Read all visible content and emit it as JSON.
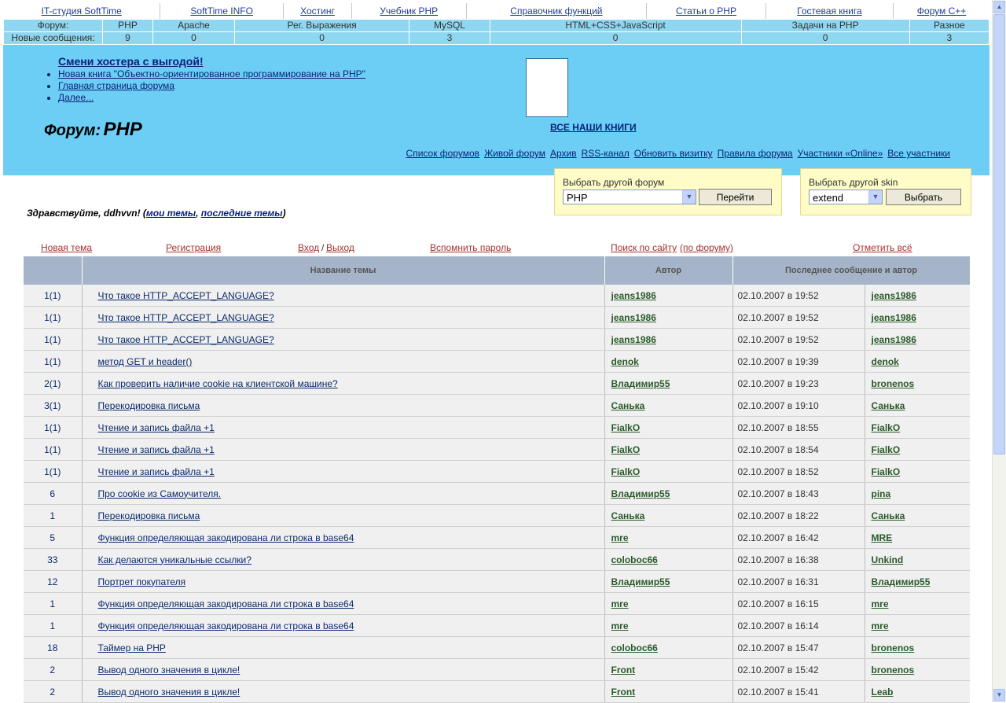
{
  "topnav": [
    "IT-студия SoftTime",
    "SoftTime INFO",
    "Хостинг",
    "Учебник PHP",
    "Справочник функций",
    "Статьи о PHP",
    "Гостевая книга",
    "Форум C++"
  ],
  "stats": {
    "forum_label": "Форум:",
    "new_label": "Новые сообщения:",
    "forums": [
      {
        "name": "PHP",
        "count": "9"
      },
      {
        "name": "Apache",
        "count": "0"
      },
      {
        "name": "Рег. Выражения",
        "count": "0"
      },
      {
        "name": "MySQL",
        "count": "3"
      },
      {
        "name": "HTML+CSS+JavaScript",
        "count": "0"
      },
      {
        "name": "Задачи на PHP",
        "count": "0"
      },
      {
        "name": "Разное",
        "count": "3"
      }
    ]
  },
  "banner": {
    "promo_title": "Смени хостера с выгодой!",
    "promo_links": [
      "Новая книга \"Объектно-ориентированное программирование на PHP\"",
      "Главная страница форума",
      "Далее..."
    ],
    "all_books": "ВСЕ НАШИ КНИГИ",
    "forum_label": "Форум:",
    "forum_name": "PHP",
    "links": [
      "Список форумов",
      "Живой форум",
      "Архив",
      "RSS-канал",
      "Обновить визитку",
      "Правила форума",
      "Участники «Online»",
      "Все участники"
    ]
  },
  "forum_select": {
    "caption": "Выбрать другой форум",
    "value": "PHP",
    "button": "Перейти"
  },
  "skin_select": {
    "caption": "Выбрать другой skin",
    "value": "extend",
    "button": "Выбрать"
  },
  "greeting": {
    "text": "Здравствуйте, ddhvvn! (",
    "my_topics": "мои темы",
    "comma": ", ",
    "last_topics": "последние темы",
    "close": ")"
  },
  "actions": {
    "new_topic": "Новая тема",
    "register": "Регистрация",
    "login": "Вход",
    "slash": "/",
    "logout": "Выход",
    "remind": "Вспомнить пароль",
    "search_site": "Поиск по сайту",
    "search_forum": "(по форуму)",
    "mark_all": "Отметить всё"
  },
  "table": {
    "headers": {
      "count": "",
      "title": "Название темы",
      "author": "Автор",
      "last": "Последнее сообщение и автор"
    },
    "rows": [
      {
        "count": "1(1)",
        "title": "Что такое HTTP_ACCEPT_LANGUAGE?",
        "author": "jeans1986",
        "date": "02.10.2007 в 19:52",
        "last_author": "jeans1986"
      },
      {
        "count": "1(1)",
        "title": "Что такое HTTP_ACCEPT_LANGUAGE?",
        "author": "jeans1986",
        "date": "02.10.2007 в 19:52",
        "last_author": "jeans1986"
      },
      {
        "count": "1(1)",
        "title": "Что такое HTTP_ACCEPT_LANGUAGE?",
        "author": "jeans1986",
        "date": "02.10.2007 в 19:52",
        "last_author": "jeans1986"
      },
      {
        "count": "1(1)",
        "title": "метод GET и header()",
        "author": "denok",
        "date": "02.10.2007 в 19:39",
        "last_author": "denok"
      },
      {
        "count": "2(1)",
        "title": "Как проверить наличие cookie на клиентской машине?",
        "author": "Владимир55",
        "date": "02.10.2007 в 19:23",
        "last_author": "bronenos"
      },
      {
        "count": "3(1)",
        "title": "Перекодировка письма",
        "author": "Санька",
        "date": "02.10.2007 в 19:10",
        "last_author": "Санька"
      },
      {
        "count": "1(1)",
        "title": "Чтение и запись файла +1",
        "author": "FialkO",
        "date": "02.10.2007 в 18:55",
        "last_author": "FialkO"
      },
      {
        "count": "1(1)",
        "title": "Чтение и запись файла +1",
        "author": "FialkO",
        "date": "02.10.2007 в 18:54",
        "last_author": "FialkO"
      },
      {
        "count": "1(1)",
        "title": "Чтение и запись файла +1",
        "author": "FialkO",
        "date": "02.10.2007 в 18:52",
        "last_author": "FialkO"
      },
      {
        "count": "6",
        "title": "Про cookie из Самоучителя.",
        "author": "Владимир55",
        "date": "02.10.2007 в 18:43",
        "last_author": "pina"
      },
      {
        "count": "1",
        "title": "Перекодировка письма",
        "author": "Санька",
        "date": "02.10.2007 в 18:22",
        "last_author": "Санька"
      },
      {
        "count": "5",
        "title": "Функция определяющая закодирована ли строка в base64",
        "author": "mre",
        "date": "02.10.2007 в 16:42",
        "last_author": "MRE"
      },
      {
        "count": "33",
        "title": "Как делаются уникальные ссылки?",
        "author": "coloboc66",
        "date": "02.10.2007 в 16:38",
        "last_author": "Unkind"
      },
      {
        "count": "12",
        "title": "Портрет покупателя",
        "author": "Владимир55",
        "date": "02.10.2007 в 16:31",
        "last_author": "Владимир55"
      },
      {
        "count": "1",
        "title": "Функция определяющая закодирована ли строка в base64",
        "author": "mre",
        "date": "02.10.2007 в 16:15",
        "last_author": "mre"
      },
      {
        "count": "1",
        "title": "Функция определяющая закодирована ли строка в base64",
        "author": "mre",
        "date": "02.10.2007 в 16:14",
        "last_author": "mre"
      },
      {
        "count": "18",
        "title": "Таймер на PHP",
        "author": "coloboc66",
        "date": "02.10.2007 в 15:47",
        "last_author": "bronenos"
      },
      {
        "count": "2",
        "title": "Вывод одного значения в цикле!",
        "author": "Front",
        "date": "02.10.2007 в 15:42",
        "last_author": "bronenos"
      },
      {
        "count": "2",
        "title": "Вывод одного значения в цикле!",
        "author": "Front",
        "date": "02.10.2007 в 15:41",
        "last_author": "Leab"
      }
    ]
  },
  "icons": {
    "dropdown": "chevron-down-icon",
    "scroll_up": "arrow-up-icon",
    "scroll_down": "arrow-down-icon"
  },
  "colors": {
    "banner": "#6ccef4",
    "stats": "#8fd7f0",
    "header_row": "#a5b4c8",
    "action_link": "#a83030",
    "author_link": "#2a5a2a",
    "select_box": "#fffcc8"
  }
}
